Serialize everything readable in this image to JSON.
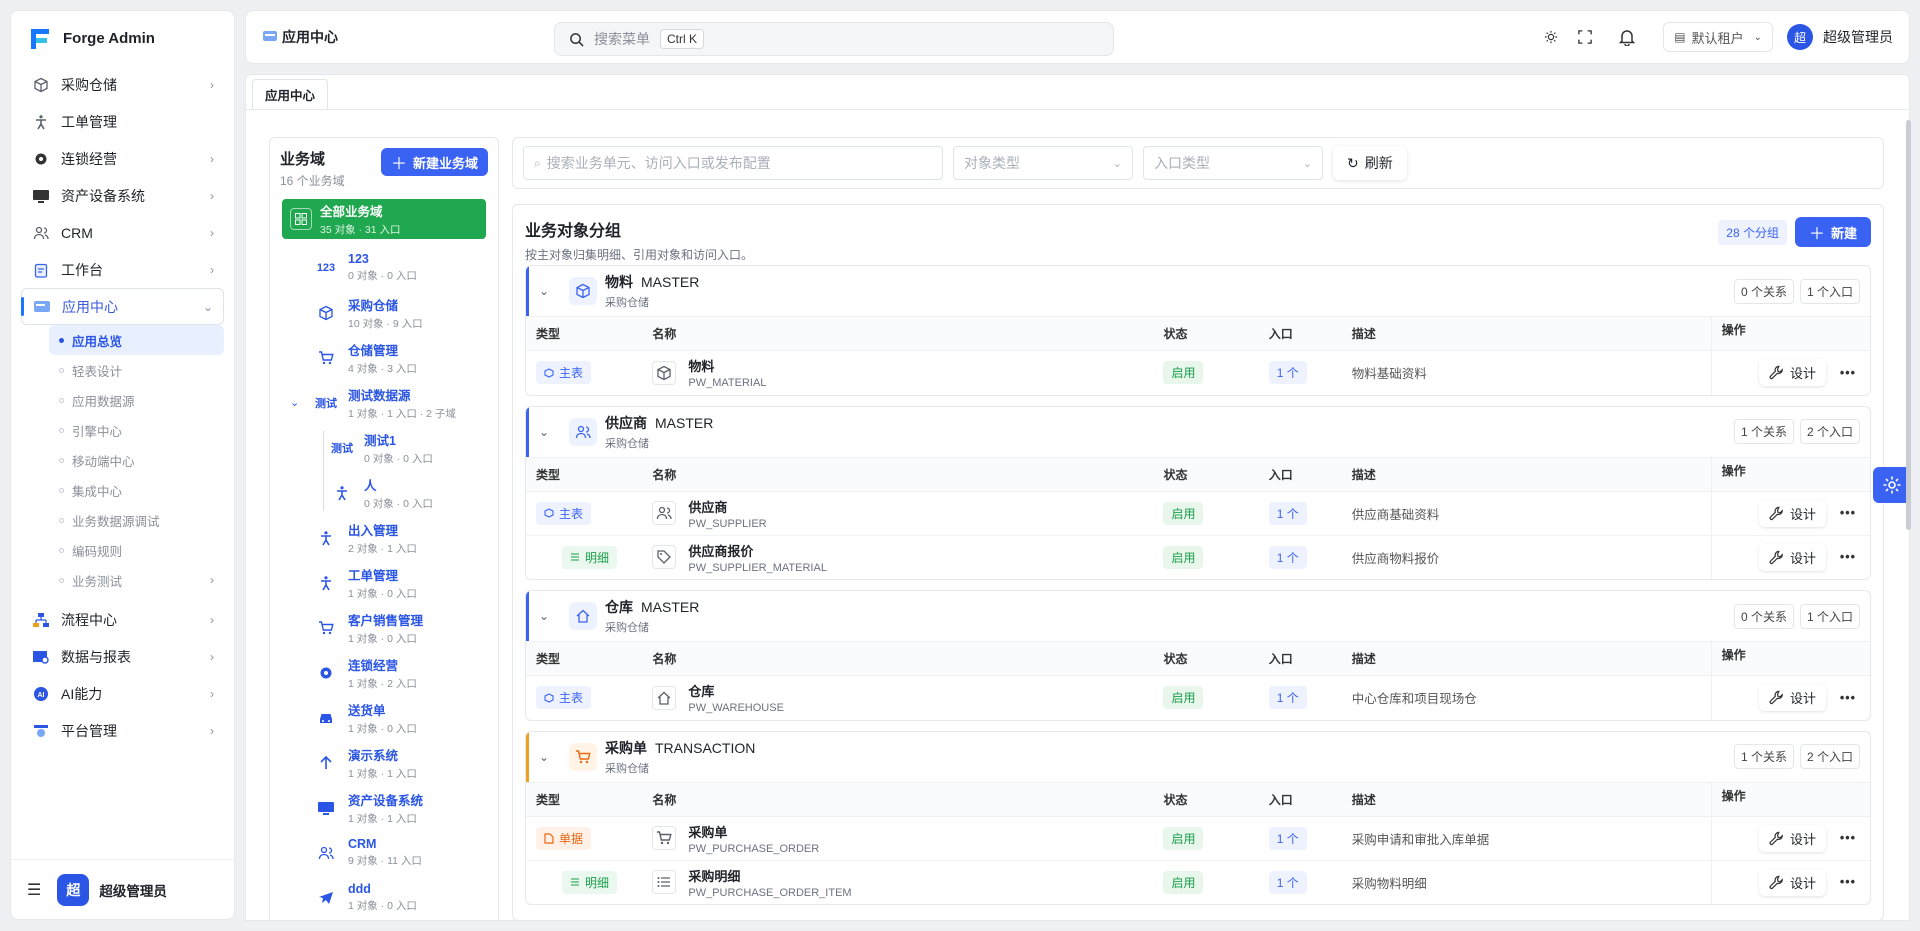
{
  "app": {
    "title": "Forge Admin",
    "page_title": "应用中心"
  },
  "sidebar": {
    "items": [
      {
        "label": "采购仓储",
        "icon": "box-icon",
        "expandable": true
      },
      {
        "label": "工单管理",
        "icon": "person-icon",
        "expandable": false
      },
      {
        "label": "连锁经营",
        "icon": "gear-icon",
        "expandable": true
      },
      {
        "label": "资产设备系统",
        "icon": "monitor-icon",
        "expandable": true
      },
      {
        "label": "CRM",
        "icon": "users-icon",
        "expandable": true
      },
      {
        "label": "工作台",
        "icon": "clipboard-icon",
        "expandable": true
      },
      {
        "label": "应用中心",
        "icon": "app-center-icon",
        "expandable": true,
        "active": true
      }
    ],
    "sub_items": [
      {
        "label": "应用总览",
        "active": true
      },
      {
        "label": "轻表设计"
      },
      {
        "label": "应用数据源"
      },
      {
        "label": "引擎中心"
      },
      {
        "label": "移动端中心"
      },
      {
        "label": "集成中心"
      },
      {
        "label": "业务数据源调试"
      },
      {
        "label": "编码规则"
      },
      {
        "label": "业务测试",
        "expandable": true
      }
    ],
    "items_after": [
      {
        "label": "流程中心",
        "icon": "flow-icon"
      },
      {
        "label": "数据与报表",
        "icon": "report-icon"
      },
      {
        "label": "AI能力",
        "icon": "ai-icon"
      },
      {
        "label": "平台管理",
        "icon": "platform-icon"
      }
    ],
    "footer": {
      "avatar_char": "超",
      "user": "超级管理员"
    }
  },
  "topbar": {
    "search_placeholder": "搜索菜单",
    "shortcut": "Ctrl K",
    "tenant": "默认租户",
    "user_avatar": "超",
    "user_name": "超级管理员"
  },
  "tabs": [
    {
      "label": "应用中心"
    }
  ],
  "domains": {
    "title": "业务域",
    "count": "16 个业务域",
    "new_button": "新建业务域",
    "all": {
      "name": "全部业务域",
      "meta": "35 对象 · 31 入口"
    },
    "items": [
      {
        "name": "123",
        "meta": "0 对象 · 0 入口",
        "icon_text": "123"
      },
      {
        "name": "采购仓储",
        "meta": "10 对象 · 9 入口",
        "icon": "box-icon"
      },
      {
        "name": "仓储管理",
        "meta": "4 对象 · 3 入口",
        "icon": "cart-icon"
      },
      {
        "name": "测试数据源",
        "meta": "1 对象 · 1 入口 · 2 子域",
        "icon_text": "测试",
        "expanded": true
      },
      {
        "name": "测试1",
        "meta": "0 对象 · 0 入口",
        "icon_text": "测试",
        "child": true
      },
      {
        "name": "人",
        "meta": "0 对象 · 0 入口",
        "icon": "person-icon",
        "child": true
      },
      {
        "name": "出入管理",
        "meta": "2 对象 · 1 入口",
        "icon": "person-icon"
      },
      {
        "name": "工单管理",
        "meta": "1 对象 · 0 入口",
        "icon": "person-icon"
      },
      {
        "name": "客户销售管理",
        "meta": "1 对象 · 0 入口",
        "icon": "cart-icon"
      },
      {
        "name": "连锁经营",
        "meta": "1 对象 · 2 入口",
        "icon": "gear-icon"
      },
      {
        "name": "送货单",
        "meta": "1 对象 · 0 入口",
        "icon": "car-icon"
      },
      {
        "name": "演示系统",
        "meta": "1 对象 · 1 入口",
        "icon": "arrow-up-icon"
      },
      {
        "name": "资产设备系统",
        "meta": "1 对象 · 1 入口",
        "icon": "monitor-icon"
      },
      {
        "name": "CRM",
        "meta": "9 对象 · 11 入口",
        "icon": "users-icon"
      },
      {
        "name": "ddd",
        "meta": "1 对象 · 0 入口",
        "icon": "plane-icon"
      }
    ]
  },
  "filters": {
    "search_placeholder": "搜索业务单元、访问入口或发布配置",
    "object_type_placeholder": "对象类型",
    "entry_type_placeholder": "入口类型",
    "refresh": "刷新"
  },
  "groups_panel": {
    "title": "业务对象分组",
    "subtitle": "按主对象归集明细、引用对象和访问入口。",
    "count": "28 个分组",
    "new_button": "新建",
    "columns": {
      "type": "类型",
      "name": "名称",
      "status": "状态",
      "entry": "入口",
      "desc": "描述",
      "ops": "操作"
    },
    "design_label": "设计",
    "more_label": "•••"
  },
  "groups": [
    {
      "name": "物料",
      "kind": "MASTER",
      "domain": "采购仓储",
      "relations": "0 个关系",
      "entries": "1 个入口",
      "icon": "box-icon",
      "accent": "#3b63f3",
      "rows": [
        {
          "type": "主表",
          "type_kind": "main",
          "name": "物料",
          "code": "PW_MATERIAL",
          "icon": "box-icon",
          "status": "启用",
          "entry": "1 个",
          "desc": "物料基础资料"
        }
      ]
    },
    {
      "name": "供应商",
      "kind": "MASTER",
      "domain": "采购仓储",
      "relations": "1 个关系",
      "entries": "2 个入口",
      "icon": "users-icon",
      "accent": "#3b63f3",
      "rows": [
        {
          "type": "主表",
          "type_kind": "main",
          "name": "供应商",
          "code": "PW_SUPPLIER",
          "icon": "users-icon",
          "status": "启用",
          "entry": "1 个",
          "desc": "供应商基础资料"
        },
        {
          "type": "明细",
          "type_kind": "detail",
          "name": "供应商报价",
          "code": "PW_SUPPLIER_MATERIAL",
          "icon": "tag-icon",
          "status": "启用",
          "entry": "1 个",
          "desc": "供应商物料报价"
        }
      ]
    },
    {
      "name": "仓库",
      "kind": "MASTER",
      "domain": "采购仓储",
      "relations": "0 个关系",
      "entries": "1 个入口",
      "icon": "home-icon",
      "accent": "#3b63f3",
      "rows": [
        {
          "type": "主表",
          "type_kind": "main",
          "name": "仓库",
          "code": "PW_WAREHOUSE",
          "icon": "home-icon",
          "status": "启用",
          "entry": "1 个",
          "desc": "中心仓库和项目现场仓"
        }
      ]
    },
    {
      "name": "采购单",
      "kind": "TRANSACTION",
      "domain": "采购仓储",
      "relations": "1 个关系",
      "entries": "2 个入口",
      "icon": "cart-icon",
      "accent": "#f0a020",
      "rows": [
        {
          "type": "单据",
          "type_kind": "doc",
          "name": "采购单",
          "code": "PW_PURCHASE_ORDER",
          "icon": "cart-icon",
          "status": "启用",
          "entry": "1 个",
          "desc": "采购申请和审批入库单据"
        },
        {
          "type": "明细",
          "type_kind": "detail",
          "name": "采购明细",
          "code": "PW_PURCHASE_ORDER_ITEM",
          "icon": "list-icon",
          "status": "启用",
          "entry": "1 个",
          "desc": "采购物料明细"
        }
      ]
    }
  ]
}
